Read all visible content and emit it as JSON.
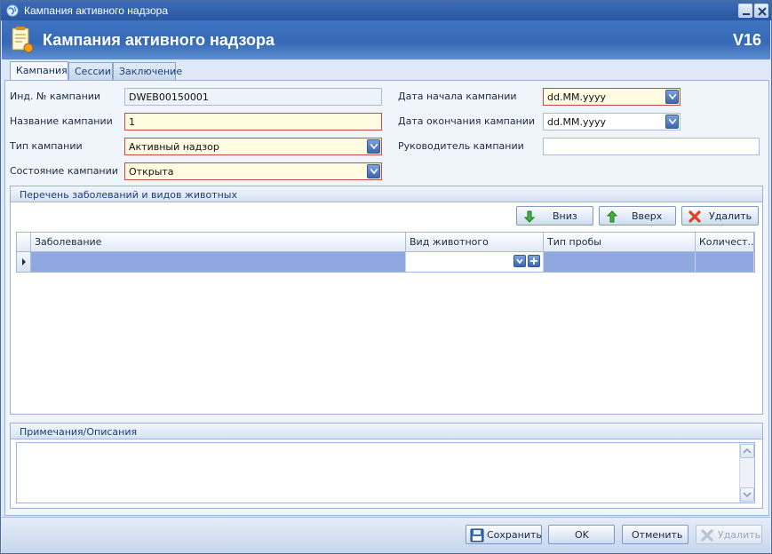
{
  "window": {
    "title": "Кампания активного надзора",
    "app_icon": "globe-icon",
    "minimize_icon": "minimize-icon",
    "close_icon": "close-icon"
  },
  "header": {
    "title": "Кампания активного надзора",
    "version": "V16",
    "icon": "document-icon"
  },
  "tabs": [
    {
      "label": "Кампания",
      "active": true
    },
    {
      "label": "Сессии",
      "active": false
    },
    {
      "label": "Заключение",
      "active": false
    }
  ],
  "form": {
    "id_label": "Инд. № кампании",
    "id_value": "DWEB00150001",
    "name_label": "Название кампании",
    "name_value": "1",
    "type_label": "Тип кампании",
    "type_value": "Активный надзор",
    "state_label": "Состояние кампании",
    "state_value": "Открыта",
    "start_label": "Дата начала кампании",
    "start_value": "dd.MM.yyyy",
    "end_label": "Дата окончания кампании",
    "end_value": "dd.MM.yyyy",
    "manager_label": "Руководитель кампании",
    "manager_value": ""
  },
  "diseases": {
    "title": "Перечень заболеваний и видов животных",
    "down_label": "Вниз",
    "up_label": "Вверх",
    "delete_label": "Удалить",
    "columns": [
      "Заболевание",
      "Вид животного",
      "Тип пробы",
      "Количест..."
    ],
    "rows": [
      [
        "",
        "",
        "",
        ""
      ]
    ]
  },
  "notes": {
    "title": "Примечания/Описания",
    "value": ""
  },
  "footer": {
    "save_label": "Сохранить",
    "ok_label": "OK",
    "cancel_label": "Отменить",
    "delete_label": "Удалить"
  },
  "colors": {
    "title_bar": "#2a57a0",
    "header": "#3569b6",
    "required_border": "#c74a4a",
    "required_bg": "#fffbe0",
    "selected_row": "#8fa8e0"
  }
}
